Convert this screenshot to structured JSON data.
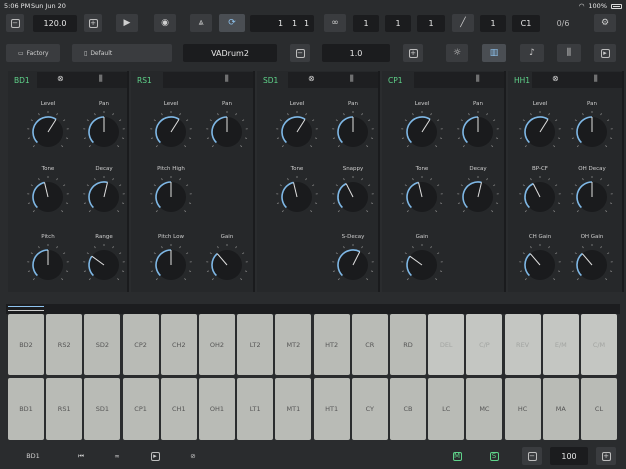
{
  "status": {
    "time": "5:06 PM",
    "date": "Sun Jun 20",
    "battery": "100%"
  },
  "transport": {
    "tempo": "120.0",
    "position": [
      "1",
      "1",
      "1"
    ],
    "loop": [
      "1",
      "1",
      "1"
    ],
    "slope": "1",
    "note": "C1",
    "counter": "0/6"
  },
  "preset": {
    "bank": "Factory",
    "preset": "Default",
    "kit": "VADrum2",
    "value": "1.0"
  },
  "channels": [
    {
      "name": "BD1",
      "knobs": [
        {
          "label": "Level",
          "v": 0.62
        },
        {
          "label": "Pan",
          "v": 0.5
        },
        {
          "label": "Tone",
          "v": 0.45
        },
        {
          "label": "Decay",
          "v": 0.55
        },
        {
          "label": "Pitch",
          "v": 0.5
        },
        {
          "label": "Range",
          "v": 0.3
        }
      ]
    },
    {
      "name": "RS1",
      "knobs": [
        {
          "label": "Level",
          "v": 0.62
        },
        {
          "label": "Pan",
          "v": 0.5
        },
        {
          "label": "Pitch High",
          "v": 0.5
        },
        {
          "label": "Pitch Low",
          "v": 0.5
        },
        {
          "label": "Gain",
          "v": 0.35
        }
      ]
    },
    {
      "name": "SD1",
      "knobs": [
        {
          "label": "Level",
          "v": 0.62
        },
        {
          "label": "Pan",
          "v": 0.5
        },
        {
          "label": "Tone",
          "v": 0.45
        },
        {
          "label": "Snappy",
          "v": 0.4
        },
        {
          "label": "S-Decay",
          "v": 0.6
        }
      ]
    },
    {
      "name": "CP1",
      "knobs": [
        {
          "label": "Level",
          "v": 0.62
        },
        {
          "label": "Pan",
          "v": 0.5
        },
        {
          "label": "Tone",
          "v": 0.45
        },
        {
          "label": "Decay",
          "v": 0.55
        },
        {
          "label": "Gain",
          "v": 0.3
        }
      ]
    },
    {
      "name": "HH1",
      "knobs": [
        {
          "label": "Level",
          "v": 0.62
        },
        {
          "label": "Pan",
          "v": 0.5
        },
        {
          "label": "BP-CF",
          "v": 0.4
        },
        {
          "label": "OH Decay",
          "v": 0.5
        },
        {
          "label": "CH Gain",
          "v": 0.35
        },
        {
          "label": "OH Gain",
          "v": 0.35
        }
      ]
    }
  ],
  "pads_top": [
    {
      "l": "BD2",
      "d": false
    },
    {
      "l": "RS2",
      "d": false
    },
    {
      "l": "SD2",
      "d": false
    },
    {
      "l": "CP2",
      "d": false
    },
    {
      "l": "CH2",
      "d": false
    },
    {
      "l": "OH2",
      "d": false
    },
    {
      "l": "LT2",
      "d": false
    },
    {
      "l": "MT2",
      "d": false
    },
    {
      "l": "HT2",
      "d": false
    },
    {
      "l": "CR",
      "d": false
    },
    {
      "l": "RD",
      "d": false
    },
    {
      "l": "DEL",
      "d": true
    },
    {
      "l": "C/P",
      "d": true
    },
    {
      "l": "REV",
      "d": true
    },
    {
      "l": "E/M",
      "d": true
    },
    {
      "l": "C/M",
      "d": true
    }
  ],
  "pads_bottom": [
    "BD1",
    "RS1",
    "SD1",
    "CP1",
    "CH1",
    "OH1",
    "LT1",
    "MT1",
    "HT1",
    "CY",
    "CB",
    "LC",
    "MC",
    "HC",
    "MA",
    "CL"
  ],
  "bottom": {
    "channel": "BD1",
    "m": "M",
    "s": "S",
    "velocity": "100"
  },
  "colors": {
    "accent": "#5fd38a",
    "knob_arc": "#7fb8e6",
    "pad": "#b9bbb6"
  }
}
